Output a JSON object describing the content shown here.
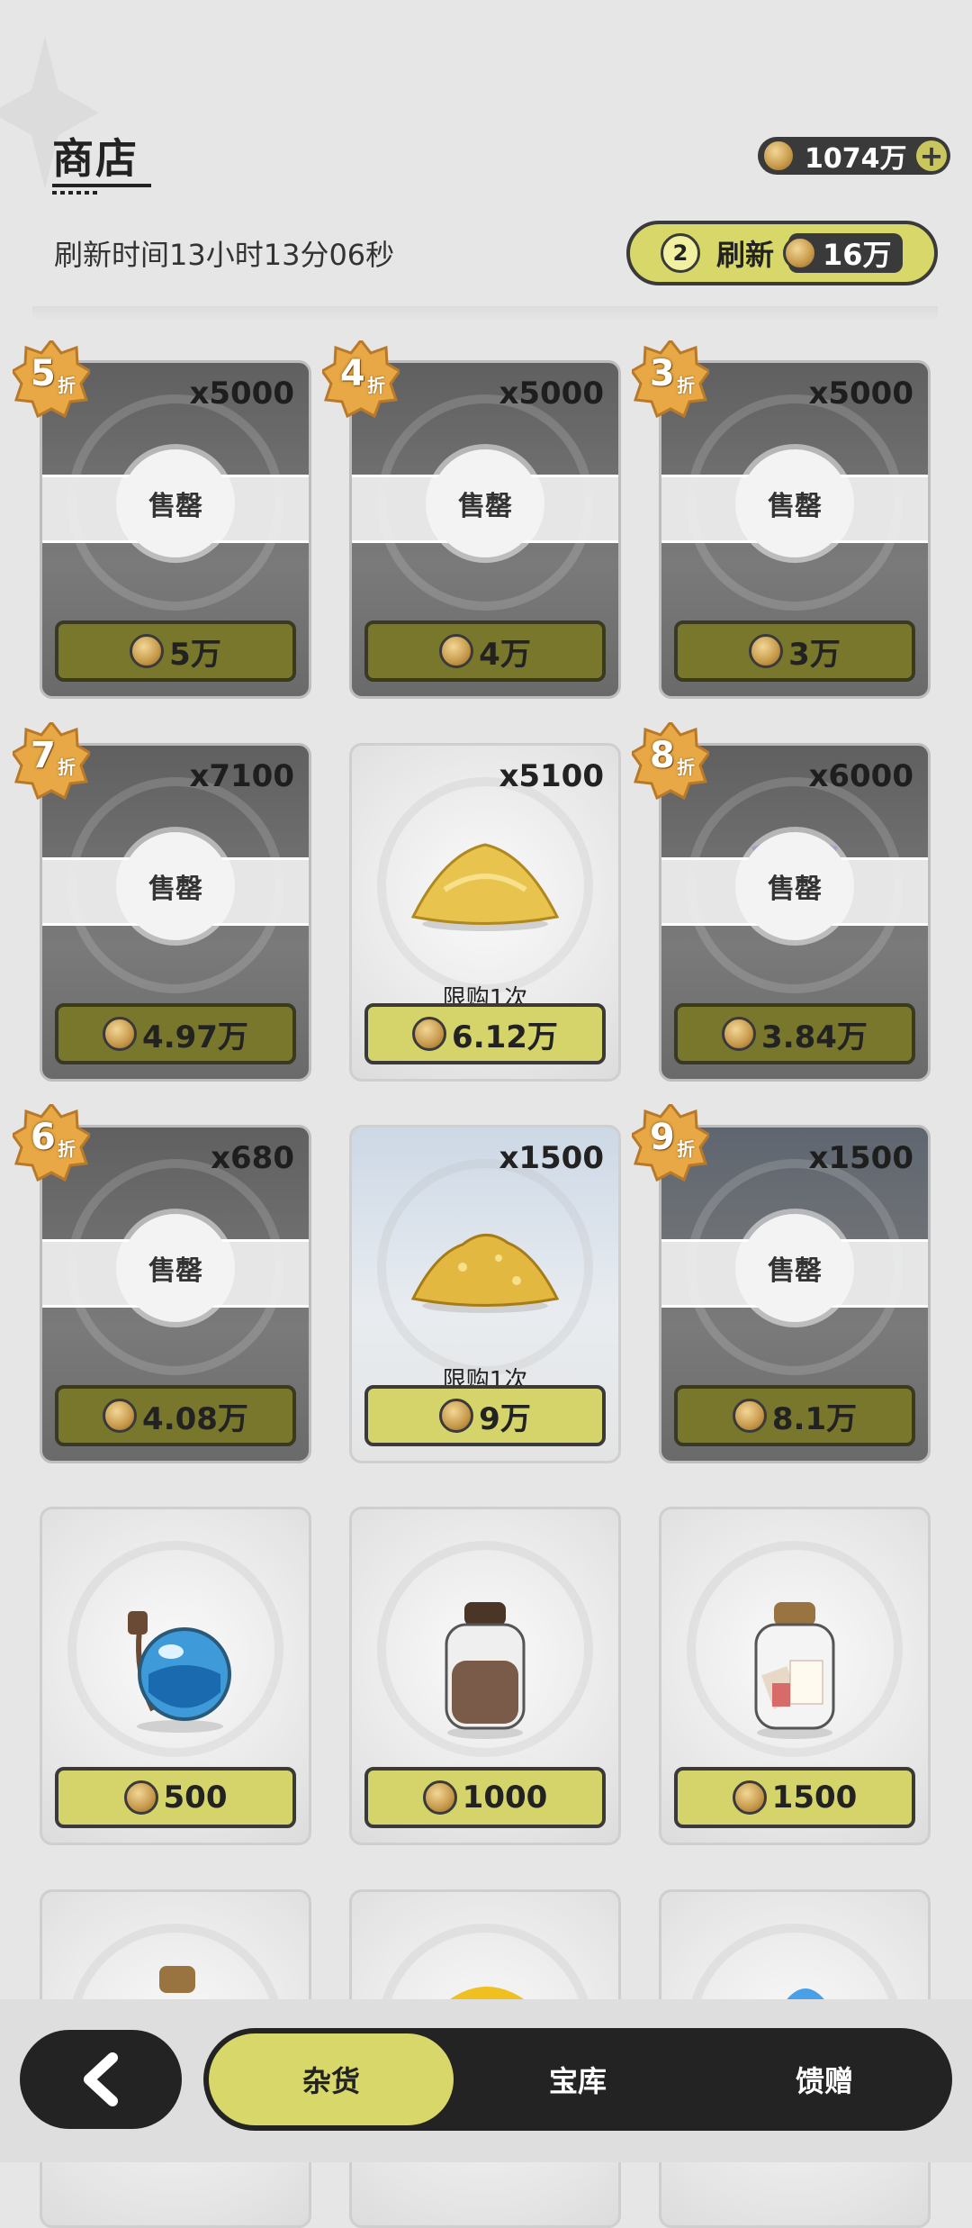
{
  "header": {
    "title": "商店",
    "currency_amount": "1074万",
    "refresh_time_text": "刷新时间13小时13分06秒",
    "refresh_button": {
      "count": "2",
      "label": "刷新",
      "cost": "16万"
    }
  },
  "shop": {
    "sold_label": "售罄",
    "limit_label": "限购1次",
    "discount_suffix": "折",
    "items": [
      {
        "qty": "x5000",
        "price": "5万",
        "discount": "5",
        "sold_out": true
      },
      {
        "qty": "x5000",
        "price": "4万",
        "discount": "4",
        "sold_out": true
      },
      {
        "qty": "x5000",
        "price": "3万",
        "discount": "3",
        "sold_out": true
      },
      {
        "qty": "x7100",
        "price": "4.97万",
        "discount": "7",
        "sold_out": true
      },
      {
        "qty": "x5100",
        "price": "6.12万",
        "sold_out": false,
        "icon": "sand-pile-icon"
      },
      {
        "qty": "x6000",
        "price": "3.84万",
        "discount": "8",
        "sold_out": true
      },
      {
        "qty": "x680",
        "price": "4.08万",
        "discount": "6",
        "sold_out": true
      },
      {
        "qty": "x1500",
        "price": "9万",
        "sold_out": false,
        "icon": "gold-sand-pile-icon"
      },
      {
        "qty": "x1500",
        "price": "8.1万",
        "discount": "9",
        "sold_out": true
      },
      {
        "price": "500",
        "sold_out": false,
        "icon": "blue-potion-icon"
      },
      {
        "price": "1000",
        "sold_out": false,
        "icon": "brown-jar-icon"
      },
      {
        "price": "1500",
        "sold_out": false,
        "icon": "white-jar-icon"
      }
    ]
  },
  "nav": {
    "tabs": [
      {
        "label": "杂货"
      },
      {
        "label": "宝库"
      },
      {
        "label": "馈赠"
      }
    ]
  }
}
